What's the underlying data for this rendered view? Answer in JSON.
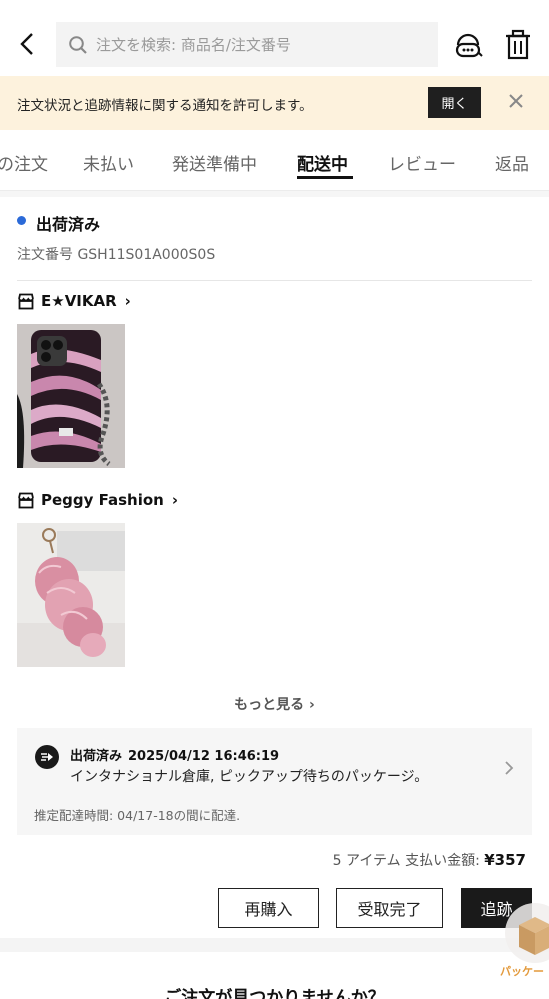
{
  "header": {
    "search_placeholder": "注文を検索: 商品名/注文番号"
  },
  "notice": {
    "text": "注文状況と追跡情報に関する通知を許可します。",
    "open_label": "開く"
  },
  "tabs": [
    {
      "label": "の注文"
    },
    {
      "label": "未払い"
    },
    {
      "label": "発送準備中"
    },
    {
      "label": "配送中",
      "active": true
    },
    {
      "label": "レビュー"
    },
    {
      "label": "返品"
    }
  ],
  "order": {
    "status": "出荷済み",
    "order_number": "注文番号 GSH11S01A000S0S",
    "status_color": "#2b6ad8"
  },
  "stores": [
    {
      "name": "E★VIKAR",
      "chevron": "›"
    },
    {
      "name": "Peggy Fashion",
      "chevron": "›"
    }
  ],
  "more": {
    "label": "もっと見る ›"
  },
  "tracking": {
    "status": "出荷済み",
    "datetime": "2025/04/12 16:46:19",
    "detail": "インタナショナル倉庫, ピックアップ待ちのパッケージ。",
    "eta": "推定配達時間: 04/17-18の間に配達."
  },
  "summary": {
    "items_label": "5 アイテム 支払い金額:",
    "amount": "¥357"
  },
  "actions": {
    "rebuy": "再購入",
    "received": "受取完了",
    "track": "追跡"
  },
  "footer": {
    "question": "ご注文が見つかりませんか？"
  },
  "floating": {
    "label": "パッケー"
  },
  "icons": {
    "back": "chevron-left-icon",
    "search": "search-icon",
    "support": "customer-service-icon",
    "trash": "trash-icon",
    "close": "close-icon",
    "store": "store-icon",
    "truck": "shipping-icon"
  }
}
